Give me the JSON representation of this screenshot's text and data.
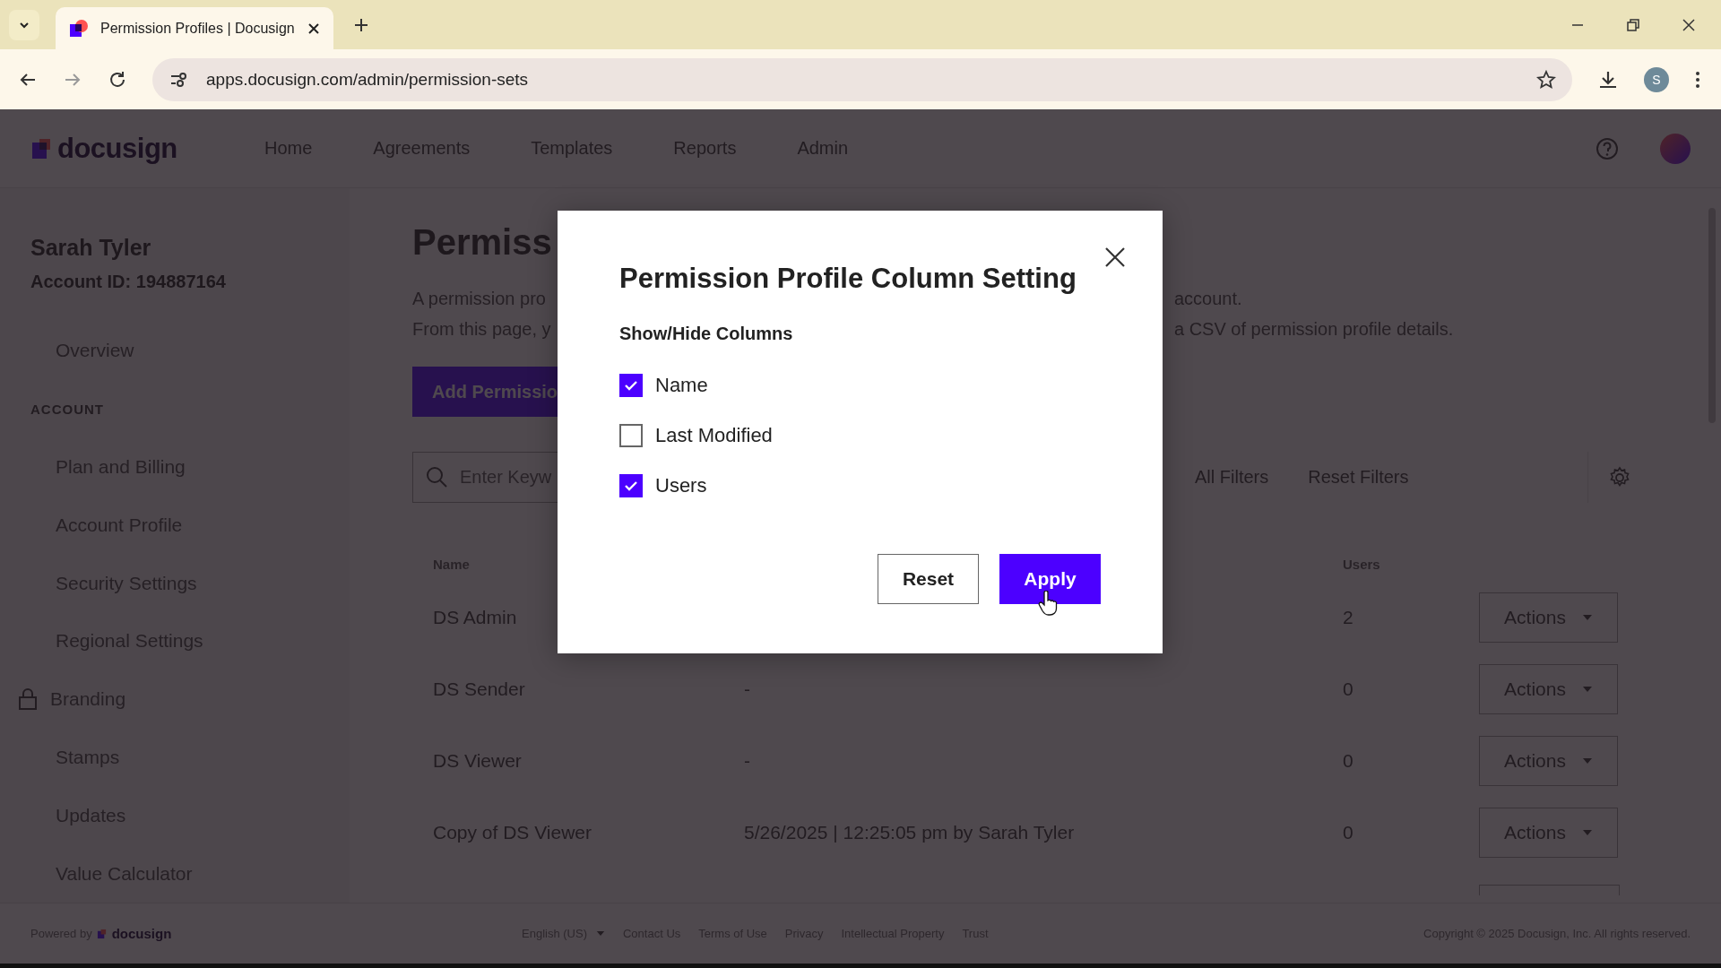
{
  "browser": {
    "tab_title": "Permission Profiles | Docusign",
    "url": "apps.docusign.com/admin/permission-sets",
    "profile_letter": "S"
  },
  "header": {
    "logo": "docusign",
    "nav": [
      "Home",
      "Agreements",
      "Templates",
      "Reports",
      "Admin"
    ]
  },
  "sidebar": {
    "user_name": "Sarah Tyler",
    "account_id": "Account ID: 194887164",
    "items": [
      {
        "kind": "link",
        "label": "Overview",
        "locked": false
      },
      {
        "kind": "heading",
        "label": "ACCOUNT"
      },
      {
        "kind": "link",
        "label": "Plan and Billing",
        "locked": false
      },
      {
        "kind": "link",
        "label": "Account Profile",
        "locked": false
      },
      {
        "kind": "link",
        "label": "Security Settings",
        "locked": false
      },
      {
        "kind": "link",
        "label": "Regional Settings",
        "locked": false
      },
      {
        "kind": "link",
        "label": "Branding",
        "locked": true
      },
      {
        "kind": "link",
        "label": "Stamps",
        "locked": false
      },
      {
        "kind": "link",
        "label": "Updates",
        "locked": false
      },
      {
        "kind": "link",
        "label": "Value Calculator",
        "locked": false
      }
    ]
  },
  "page": {
    "title": "Permiss",
    "description": [
      {
        "left": "A permission pro",
        "right": "account."
      },
      {
        "left": "From this page, y",
        "right": "a CSV of permission profile details."
      }
    ],
    "add_button": "Add Permissio",
    "search": {
      "placeholder": "Enter Keyw"
    },
    "filters": [
      "All Filters",
      "Reset Filters"
    ],
    "table": {
      "columns": [
        "Name",
        "Users"
      ],
      "rows": [
        {
          "name": "DS Admin",
          "users": "2",
          "action": "Actions"
        },
        {
          "name": "DS Sender",
          "last_modified": "-",
          "users": "0",
          "action": "Actions"
        },
        {
          "name": "DS Viewer",
          "last_modified": "-",
          "users": "0",
          "action": "Actions"
        },
        {
          "name": "Copy of DS Viewer",
          "last_modified": "5/26/2025 | 12:25:05 pm by Sarah Tyler",
          "users": "0",
          "action": "Actions"
        }
      ]
    }
  },
  "modal": {
    "title": "Permission Profile Column Setting",
    "subtitle": "Show/Hide Columns",
    "options": [
      {
        "label": "Name",
        "checked": true
      },
      {
        "label": "Last Modified",
        "checked": false
      },
      {
        "label": "Users",
        "checked": true
      }
    ],
    "buttons": [
      {
        "label": "Reset",
        "kind": "secondary"
      },
      {
        "label": "Apply",
        "kind": "primary"
      }
    ]
  },
  "footer": {
    "powered_by": "Powered by",
    "logo": "docusign",
    "language": "English (US)",
    "links": [
      "Contact Us",
      "Terms of Use",
      "Privacy",
      "Intellectual Property",
      "Trust"
    ],
    "copyright": "Copyright © 2025 Docusign, Inc. All rights reserved."
  }
}
